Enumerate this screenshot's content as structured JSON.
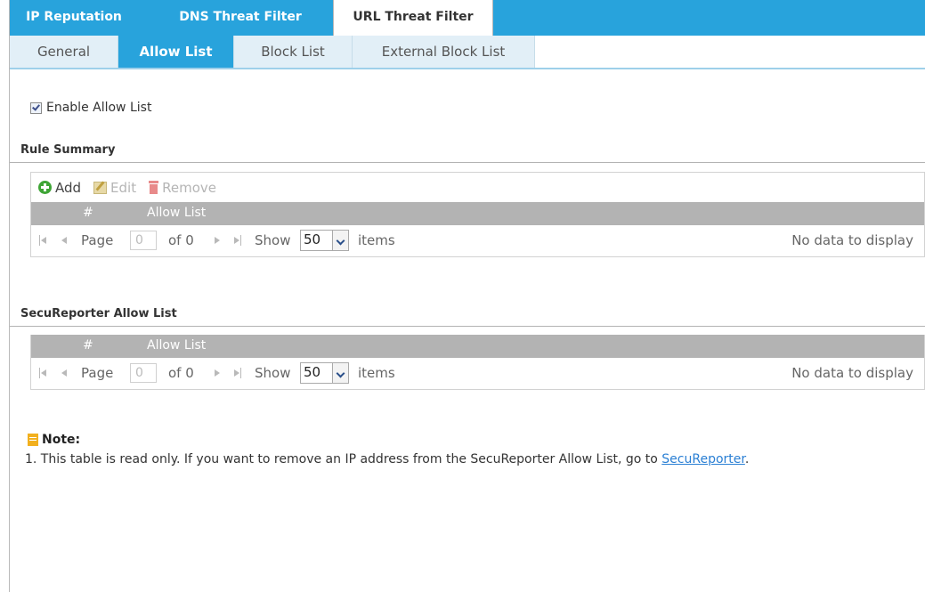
{
  "top_tabs": [
    {
      "label": "IP Reputation",
      "active": false
    },
    {
      "label": "DNS Threat Filter",
      "active": false
    },
    {
      "label": "URL Threat Filter",
      "active": true
    }
  ],
  "sub_tabs": [
    {
      "label": "General",
      "active": false
    },
    {
      "label": "Allow List",
      "active": true
    },
    {
      "label": "Block List",
      "active": false
    },
    {
      "label": "External Block List",
      "active": false
    }
  ],
  "enable": {
    "label": "Enable Allow List",
    "checked": true
  },
  "rule_summary": {
    "title": "Rule Summary",
    "toolbar": {
      "add": "Add",
      "edit": "Edit",
      "remove": "Remove"
    },
    "columns": [
      "#",
      "Allow List"
    ],
    "pager": {
      "page_label": "Page",
      "page_value": "0",
      "of_label": "of 0",
      "show_label": "Show",
      "show_value": "50",
      "items_label": "items",
      "status": "No data to display"
    }
  },
  "secureporter": {
    "title": "SecuReporter Allow List",
    "columns": [
      "#",
      "Allow List"
    ],
    "pager": {
      "page_label": "Page",
      "page_value": "0",
      "of_label": "of 0",
      "show_label": "Show",
      "show_value": "50",
      "items_label": "items",
      "status": "No data to display"
    }
  },
  "note": {
    "title": "Note:",
    "text": "1. This table is read only. If you want to remove an IP address from the SecuReporter Allow List, go to ",
    "link": "SecuReporter",
    "suffix": "."
  },
  "colors": {
    "accent": "#28a3dc",
    "header_gray": "#b3b3b3",
    "link": "#2a7fd4"
  }
}
